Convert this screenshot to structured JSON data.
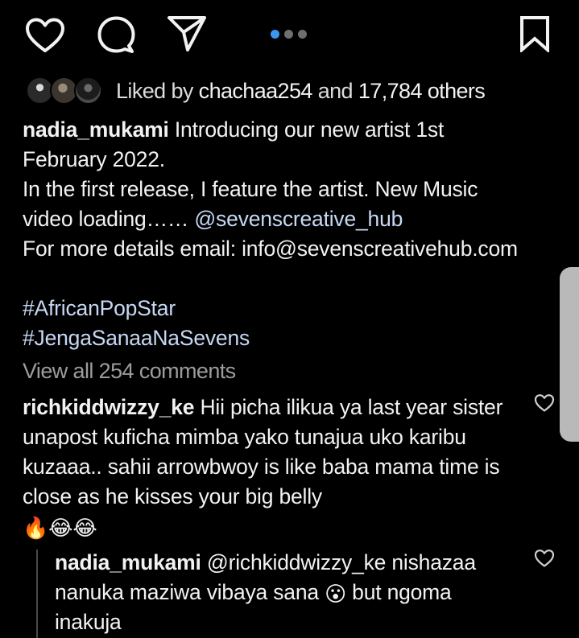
{
  "actions": {
    "like_icon": "heart-outline-icon",
    "comment_icon": "comment-bubble-icon",
    "share_icon": "paper-plane-icon",
    "save_icon": "bookmark-outline-icon"
  },
  "carousel": {
    "total": 3,
    "active_index": 0,
    "active_color": "#3897f0",
    "inactive_color": "#6f6f6f"
  },
  "likes": {
    "prefix": "Liked by",
    "user": "chachaa254",
    "connector": "and",
    "others": "17,784 others"
  },
  "post": {
    "username": "nadia_mukami",
    "lines": [
      "Introducing our new artist 1st",
      "February 2022.",
      "In the first release, I feature the artist. New Music",
      "video loading……"
    ],
    "mention": "@sevenscreative_hub",
    "email_line": "For more details email: info@sevenscreativehub.com",
    "hashtags": [
      "#AfricanPopStar",
      "#JengaSanaaNaSevens"
    ]
  },
  "view_comments": "View all 254 comments",
  "comments": [
    {
      "username": "richkiddwizzy_ke",
      "text": "Hii picha ilikua ya last year sister unapost kuficha mimba yako tunajua uko karibu kuzaaa.. sahii arrowbwoy is like baba mama time is close as he kisses your big  belly",
      "emojis": "🔥😂😂"
    }
  ],
  "replies": [
    {
      "username": "nadia_mukami",
      "mention": "@richkiddwizzy_ke",
      "text_before_emoji": "nishazaa nanuka maziwa vibaya sana",
      "emoji": "😮",
      "text_after_emoji": "but ngoma inakuja"
    }
  ]
}
